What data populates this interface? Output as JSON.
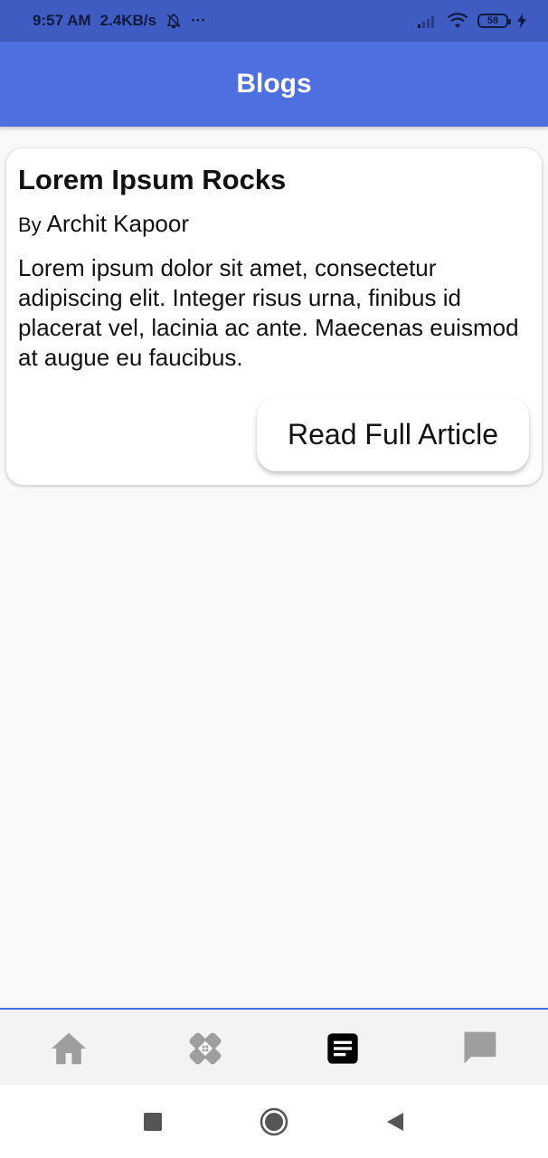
{
  "status_bar": {
    "time": "9:57 AM",
    "speed": "2.4KB/s",
    "more": "···",
    "battery": "58"
  },
  "app_bar": {
    "title": "Blogs"
  },
  "article": {
    "title": "Lorem Ipsum Rocks",
    "by": "By",
    "author": "Archit Kapoor",
    "body": "Lorem ipsum dolor sit amet, consectetur adipiscing elit. Integer risus urna, finibus id placerat vel, lacinia ac ante. Maecenas euismod at augue eu faucibus.",
    "button_label": "Read Full Article"
  },
  "bottom_nav": {
    "items": [
      "home-icon",
      "bandage-icon",
      "article-icon",
      "chat-icon"
    ],
    "selected": "article-icon"
  },
  "colors": {
    "status_bar": "#3f5cc2",
    "app_bar": "#4e6fdf",
    "nav_inactive": "#9e9e9e",
    "nav_active": "#000000"
  }
}
